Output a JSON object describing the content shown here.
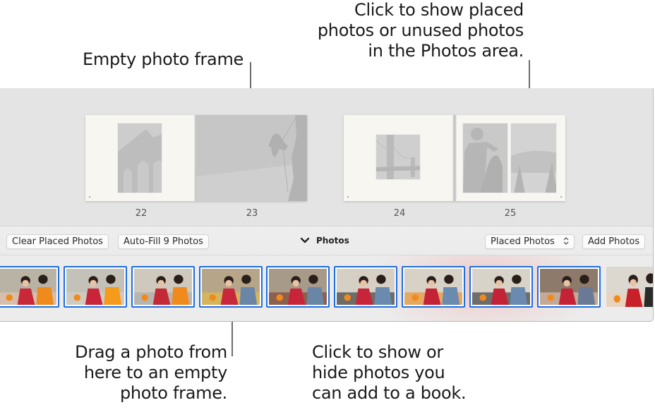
{
  "callouts": {
    "empty_frame": [
      "Empty photo frame"
    ],
    "placed_toggle": [
      "Click to show placed",
      "photos or unused photos",
      "in the Photos area."
    ],
    "drag_photo": [
      "Drag a photo from",
      "here to an empty",
      "photo frame."
    ],
    "show_hide": [
      "Click to show or",
      "hide photos you",
      "can add to a book."
    ]
  },
  "book": {
    "pages": [
      {
        "number": "22",
        "layout": "single-frame",
        "placeholder": "building-arches"
      },
      {
        "number": "23",
        "layout": "full-bleed",
        "placeholder": "rock-climber"
      },
      {
        "number": "24",
        "layout": "single-frame",
        "placeholder": "golden-gate-bridge"
      },
      {
        "number": "25",
        "layout": "two-frames",
        "placeholder": "boy-with-dog, pine-trees-lake"
      }
    ]
  },
  "toolbar": {
    "clear_label": "Clear Placed Photos",
    "autofill_label": "Auto-Fill 9 Photos",
    "photos_toggle_label": "Photos",
    "photos_toggle_icon": "chevron-down-icon",
    "filter_popup": {
      "selected": "Placed Photos",
      "icon": "up-down-arrows-icon"
    },
    "add_label": "Add Photos"
  },
  "photos": {
    "thumbnails": [
      {
        "subject": "girl holding orange with laughing woman",
        "placed": true
      },
      {
        "subject": "girl with oranges and red envelope",
        "placed": true
      },
      {
        "subject": "girl and grandfather with oranges",
        "placed": true
      },
      {
        "subject": "family with gift box",
        "placed": true
      },
      {
        "subject": "father and girl with red bag",
        "placed": true
      },
      {
        "subject": "girl with father and red toy",
        "placed": true
      },
      {
        "subject": "girl with father and oranges",
        "placed": true
      },
      {
        "subject": "girl sitting with father",
        "placed": true
      },
      {
        "subject": "girl reaching toward hands",
        "placed": true
      },
      {
        "subject": "smiling child in red shirt",
        "placed": false
      }
    ],
    "selection_color": "#1f6fe0"
  }
}
